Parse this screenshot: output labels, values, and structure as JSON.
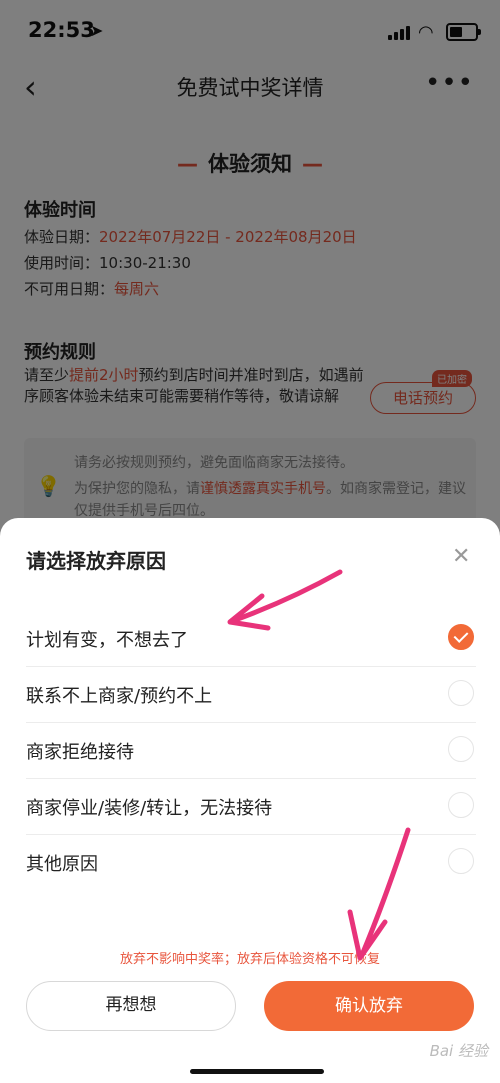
{
  "status_bar": {
    "time": "22:53",
    "location_icon": "location-arrow-icon"
  },
  "nav": {
    "title": "免费试中奖详情"
  },
  "section_title": "体验须知",
  "experience_time": {
    "heading": "体验时间",
    "date_label": "体验日期：",
    "date_value": "2022年07月22日 - 2022年08月20日",
    "use_label": "使用时间：",
    "use_value": "10:30-21:30",
    "unavail_label": "不可用日期：",
    "unavail_value": "每周六"
  },
  "booking_rules": {
    "heading": "预约规则",
    "text_pre": "请至少",
    "text_highlight": "提前2小时",
    "text_post": "预约到店时间并准时到店，如遇前序顾客体验未结束可能需要稍作等待，敬请谅解",
    "call_button": "电话预约",
    "call_tag": "已加密"
  },
  "tip": {
    "line1": "请务必按规则预约，避免面临商家无法接待。",
    "line2_pre": "为保护您的隐私，请",
    "line2_highlight": "谨慎透露真实手机号",
    "line2_post": "。如商家需登记，建议仅提供手机号后四位。"
  },
  "sheet": {
    "title": "请选择放弃原因",
    "options": [
      {
        "label": "计划有变，不想去了",
        "selected": true
      },
      {
        "label": "联系不上商家/预约不上",
        "selected": false
      },
      {
        "label": "商家拒绝接待",
        "selected": false
      },
      {
        "label": "商家停业/装修/转让，无法接待",
        "selected": false
      },
      {
        "label": "其他原因",
        "selected": false
      }
    ],
    "notice": "放弃不影响中奖率；放弃后体验资格不可恢复",
    "cancel_label": "再想想",
    "confirm_label": "确认放弃"
  },
  "watermark": "Bai 经验",
  "colors": {
    "accent": "#f26a37",
    "highlight": "#e8553d",
    "annotation": "#e8337a"
  }
}
